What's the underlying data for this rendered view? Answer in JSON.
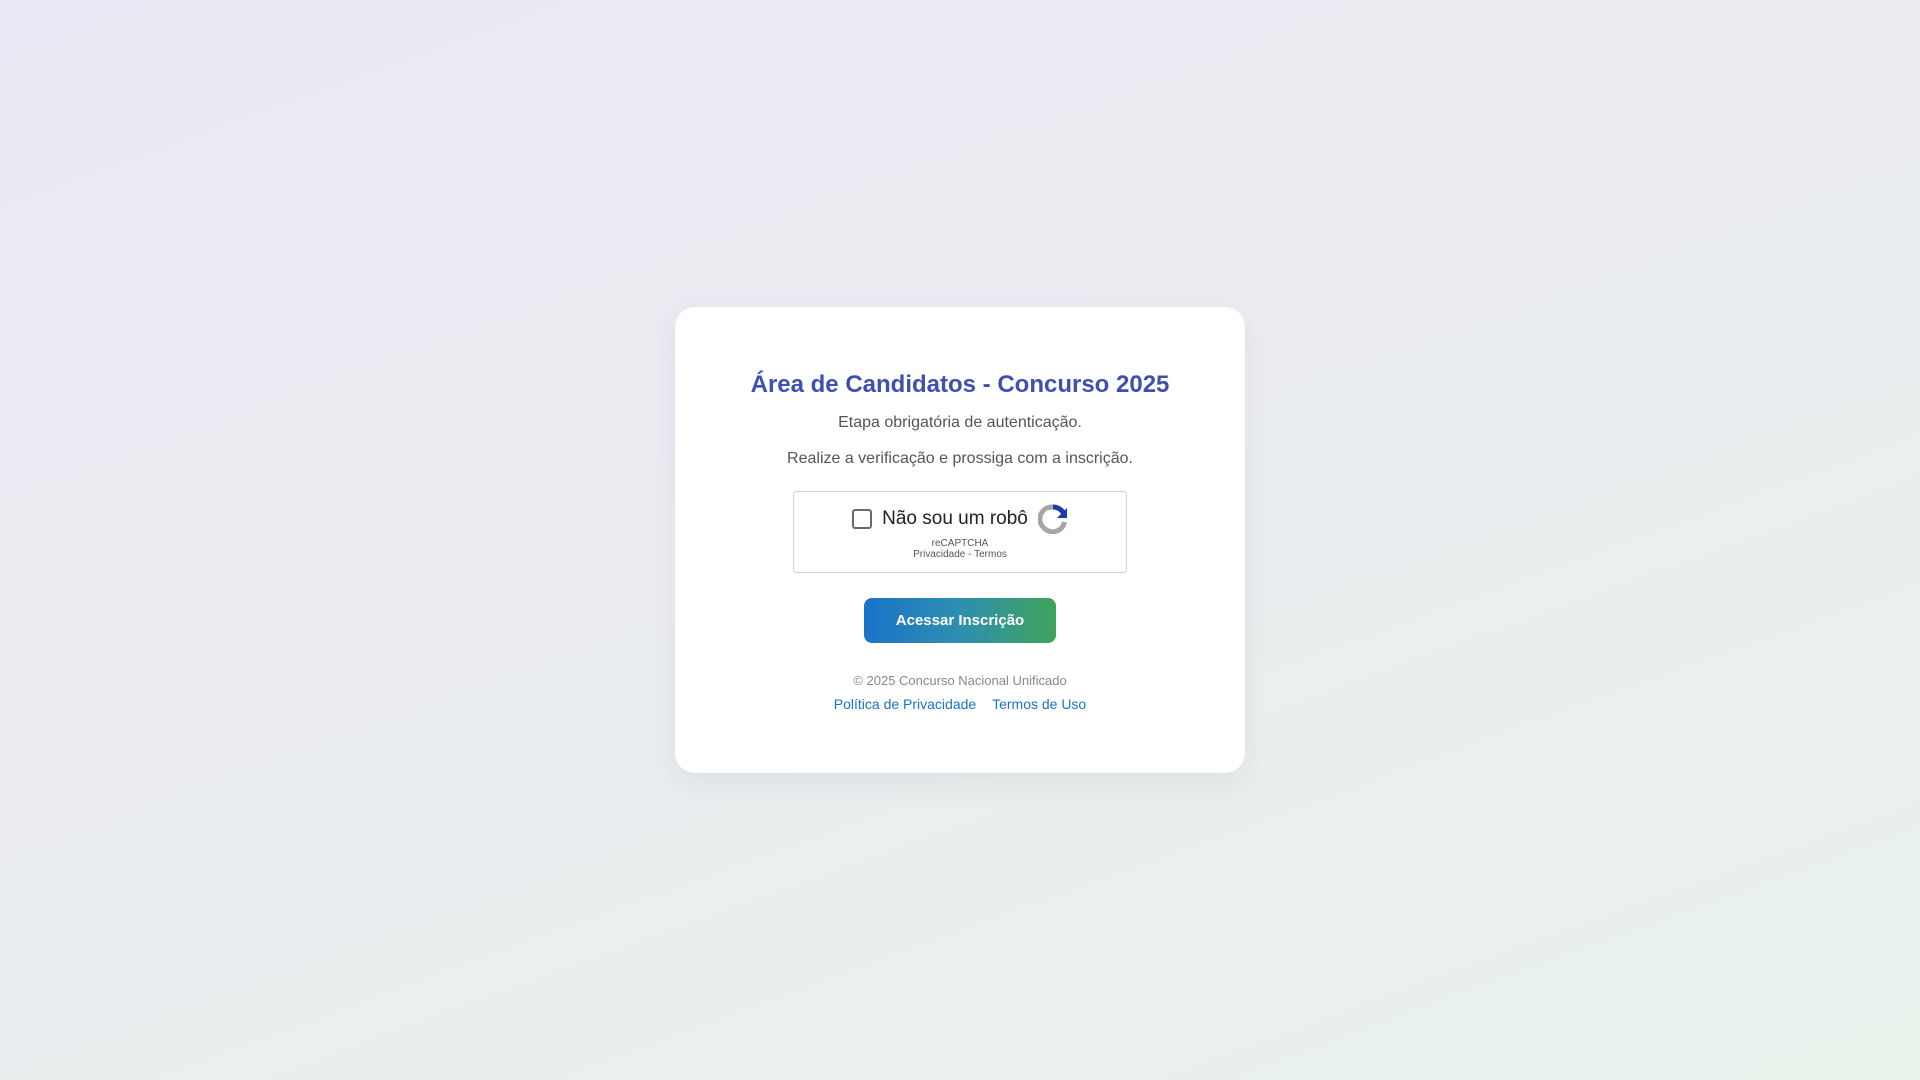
{
  "card": {
    "title": "Área de Candidatos - Concurso 2025",
    "subtitle": "Etapa obrigatória de autenticação.",
    "instruction": "Realize a verificação e prossiga com a inscrição."
  },
  "recaptcha": {
    "label": "Não sou um robô",
    "brand": "reCAPTCHA",
    "privacy_link": "Privacidade",
    "separator": " - ",
    "terms_link": "Termos",
    "checked": false,
    "logo_icon": "recaptcha-logo-icon"
  },
  "button": {
    "label": "Acessar Inscrição"
  },
  "footer": {
    "copyright": "© 2025 Concurso Nacional Unificado",
    "links": [
      {
        "label": "Política de Privacidade"
      },
      {
        "label": "Termos de Uso"
      }
    ]
  },
  "colors": {
    "title": "#3f4fb3",
    "link": "#1a73c8",
    "button_start": "#1a73c8",
    "button_end": "#3ea35a"
  }
}
